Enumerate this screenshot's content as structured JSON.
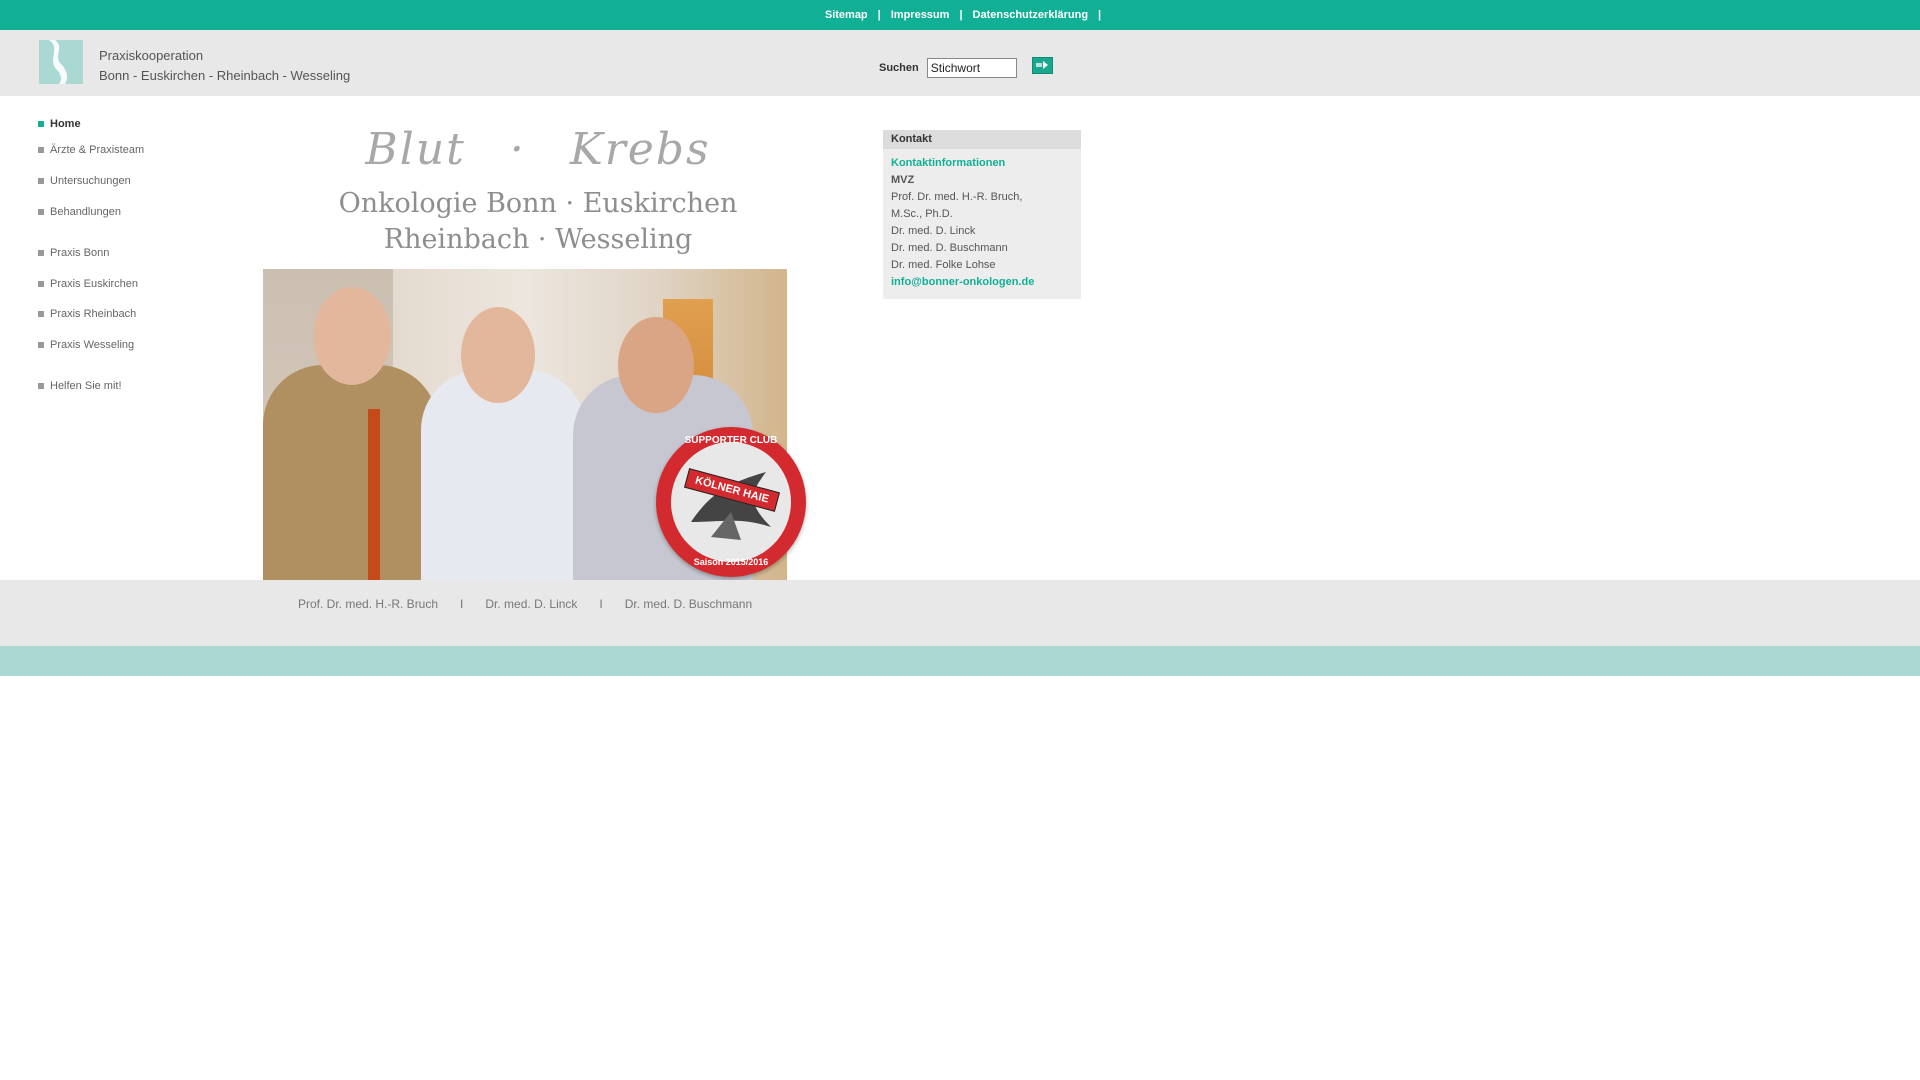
{
  "topnav": {
    "items": [
      "Sitemap",
      "Impressum",
      "Datenschutzerklärung"
    ],
    "separator": "|"
  },
  "header": {
    "title_line1": "Praxiskooperation",
    "title_line2": "Bonn - Euskirchen - Rheinbach - Wesseling"
  },
  "search": {
    "label": "Suchen",
    "value": "Stichwort"
  },
  "sidebar": {
    "items": [
      {
        "label": "Home",
        "active": true
      },
      {
        "label": "Ärzte & Praxisteam"
      },
      {
        "label": "Untersuchungen"
      },
      {
        "label": "Behandlungen"
      },
      {
        "label": "Praxis Bonn"
      },
      {
        "label": "Praxis Euskirchen"
      },
      {
        "label": "Praxis Rheinbach"
      },
      {
        "label": "Praxis Wesseling"
      },
      {
        "label": "Helfen Sie mit!"
      }
    ]
  },
  "hero": {
    "title1_left": "Blut",
    "title1_dot": "·",
    "title1_right": "Krebs",
    "subtitle_line1": "Onkologie Bonn · Euskirchen",
    "subtitle_line2": "Rheinbach · Wesseling",
    "badge_top": "SUPPORTER CLUB",
    "badge_banner": "KÖLNER HAIE",
    "badge_bottom": "Saison 2015/2016"
  },
  "kontakt": {
    "heading": "Kontakt",
    "link": "Kontaktinformationen",
    "org": "MVZ",
    "doctor1": "Prof. Dr. med. H.-R. Bruch,",
    "doctor1_suffix": "M.Sc., Ph.D.",
    "doctor2": "Dr. med. D. Linck",
    "doctor3": "Dr. med. D. Buschmann",
    "doctor4": "Dr. med. Folke Lohse",
    "email": "info@bonner-onkologen.de"
  },
  "names_bar": {
    "names": [
      "Prof. Dr. med. H.-R. Bruch",
      "Dr. med. D. Linck",
      "Dr. med. D. Buschmann"
    ],
    "separator": "I"
  },
  "colors": {
    "accent": "#11b096",
    "header_bg": "#e8e8e8",
    "footer_strip": "#aad9d3"
  }
}
